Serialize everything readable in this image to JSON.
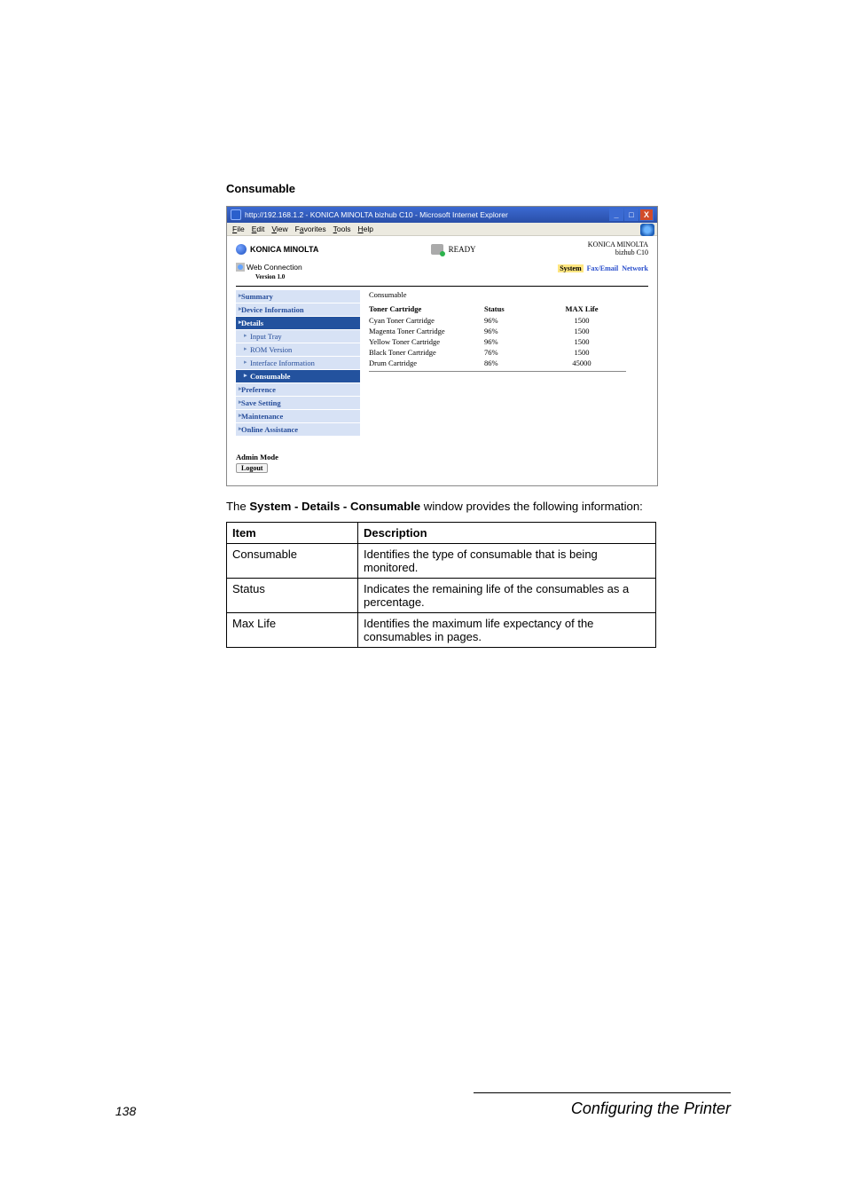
{
  "section_title": "Consumable",
  "browser": {
    "title": "http://192.168.1.2 - KONICA MINOLTA bizhub C10 - Microsoft Internet Explorer",
    "menu": {
      "file": "File",
      "edit": "Edit",
      "view": "View",
      "favorites": "Favorites",
      "tools": "Tools",
      "help": "Help"
    },
    "controls": {
      "min": "_",
      "max": "□",
      "close": "X"
    }
  },
  "header": {
    "brand": "KONICA MINOLTA",
    "ready": "READY",
    "brand_right_line1": "KONICA MINOLTA",
    "brand_right_line2": "bizhub C10",
    "webconn": "Web Connection",
    "version": "Version 1.0",
    "tabs": {
      "system": "System",
      "fax_email": "Fax/Email",
      "network": "Network"
    }
  },
  "sidebar": {
    "summary": "Summary",
    "device_info": "Device Information",
    "details": "Details",
    "input_tray": "Input Tray",
    "rom_version": "ROM Version",
    "interface_info": "Interface Information",
    "consumable": "Consumable",
    "preference": "Preference",
    "save_setting": "Save Setting",
    "maintenance": "Maintenance",
    "online_assist": "Online Assistance"
  },
  "admin": {
    "label": "Admin Mode",
    "logout": "Logout"
  },
  "main": {
    "heading": "Consumable",
    "col1": "Toner Cartridge",
    "col2": "Status",
    "col3": "MAX Life",
    "rows": [
      {
        "name": "Cyan Toner Cartridge",
        "status": "96%",
        "max": "1500"
      },
      {
        "name": "Magenta Toner Cartridge",
        "status": "96%",
        "max": "1500"
      },
      {
        "name": "Yellow Toner Cartridge",
        "status": "96%",
        "max": "1500"
      },
      {
        "name": "Black Toner Cartridge",
        "status": "76%",
        "max": "1500"
      },
      {
        "name": "Drum Cartridge",
        "status": "86%",
        "max": "45000"
      }
    ]
  },
  "caption": {
    "prefix": "The ",
    "bold": "System - Details - Consumable",
    "suffix": " window provides the following information:"
  },
  "table": {
    "h1": "Item",
    "h2": "Description",
    "rows": [
      {
        "item": "Consumable",
        "desc": "Identifies the type of consumable that is being monitored."
      },
      {
        "item": "Status",
        "desc": "Indicates the remaining life of the consumables as a percentage."
      },
      {
        "item": "Max Life",
        "desc": "Identifies the maximum life expectancy of the consumables in pages."
      }
    ]
  },
  "footer": {
    "page": "138",
    "title": "Configuring the Printer"
  }
}
